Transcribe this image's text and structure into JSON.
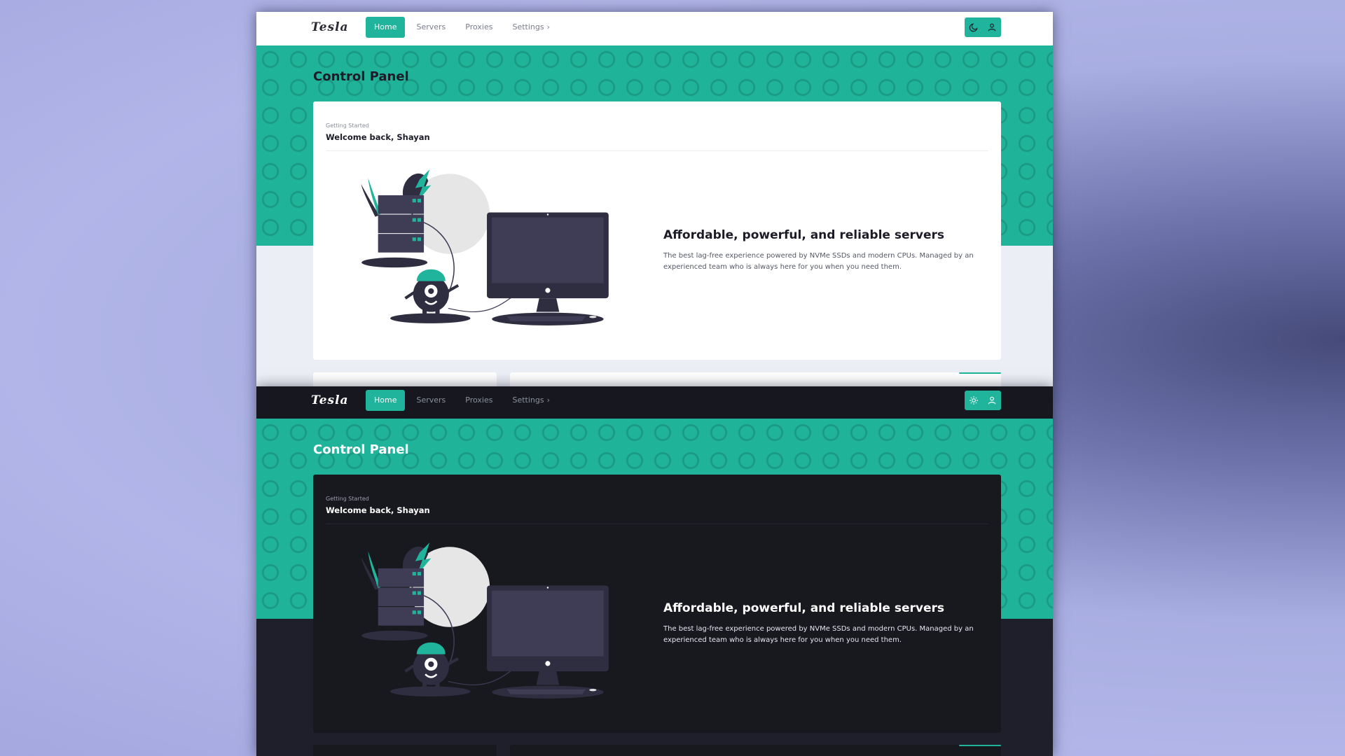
{
  "brand": {
    "logo": "Tesla",
    "accent": "#1fb49b",
    "dark_bg": "#1f1f2b",
    "light_bg": "#eceef5"
  },
  "nav": {
    "items": [
      {
        "label": "Home",
        "active": true
      },
      {
        "label": "Servers",
        "active": false
      },
      {
        "label": "Proxies",
        "active": false
      },
      {
        "label": "Settings",
        "active": false,
        "icon": "chevron-right-icon"
      }
    ],
    "theme_icon_light": "moon-icon",
    "theme_icon_dark": "sun-icon",
    "user_icon": "user-icon"
  },
  "page": {
    "title": "Control Panel"
  },
  "welcome_card": {
    "subtitle": "Getting Started",
    "title": "Welcome back, Shayan",
    "feature_title": "Affordable, powerful, and reliable servers",
    "feature_description": "The best lag-free experience powered by NVMe SSDs and modern CPUs. Managed by an experienced team who is always here for you when you need them."
  }
}
